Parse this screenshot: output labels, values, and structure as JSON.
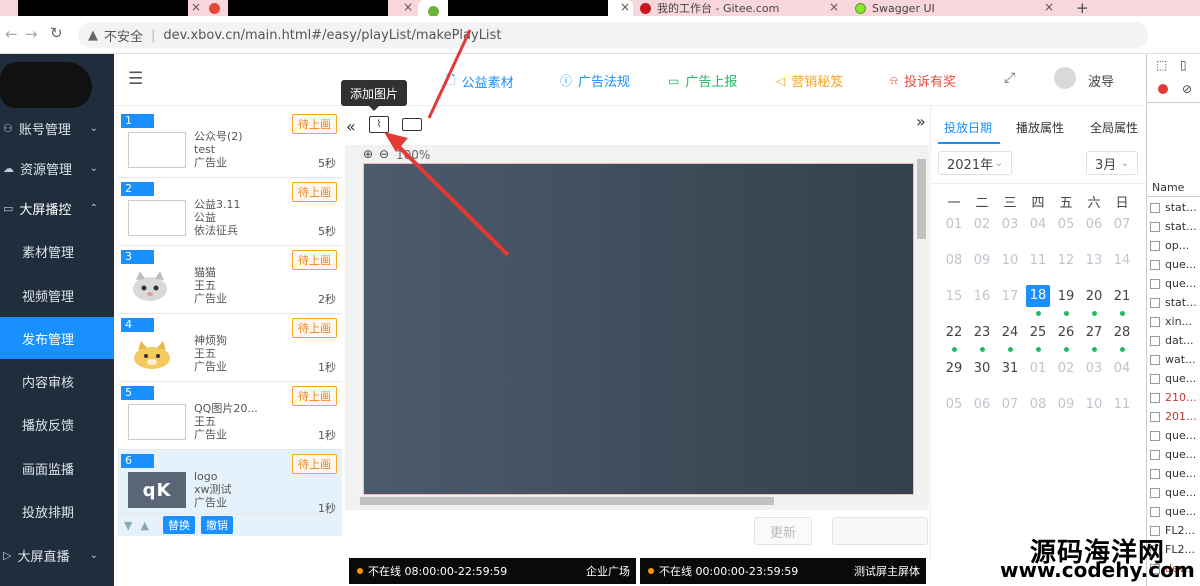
{
  "browser": {
    "tabs": [
      {
        "title": "我的工作台 - Gitee.com"
      },
      {
        "title": "Swagger UI"
      }
    ],
    "url": {
      "warning": "不安全",
      "address": "dev.xbov.cn/main.html#/easy/playList/makePlayList"
    }
  },
  "sidebar": {
    "items": [
      {
        "label": "账号管理",
        "icon": "user-icon"
      },
      {
        "label": "资源管理",
        "icon": "cloud-icon"
      },
      {
        "label": "大屏播控",
        "icon": "monitor-icon"
      },
      {
        "label": "素材管理"
      },
      {
        "label": "视频管理"
      },
      {
        "label": "发布管理"
      },
      {
        "label": "内容审核"
      },
      {
        "label": "播放反馈"
      },
      {
        "label": "画面监播"
      },
      {
        "label": "投放排期"
      },
      {
        "label": "大屏直播",
        "icon": "play-icon"
      }
    ]
  },
  "header": {
    "links": [
      {
        "label": "公益素材",
        "icon": "doc-icon",
        "color": "#1890ff"
      },
      {
        "label": "广告法规",
        "icon": "info-icon",
        "color": "#1890ff"
      },
      {
        "label": "广告上报",
        "icon": "monitor-icon",
        "color": "#25b864"
      },
      {
        "label": "营销秘笈",
        "icon": "horn-icon",
        "color": "#f5a623"
      },
      {
        "label": "投诉有奖",
        "icon": "alarm-icon",
        "color": "#e74c3c"
      }
    ],
    "user": "波导"
  },
  "playlist": [
    {
      "num": "1",
      "status": "待上画",
      "name": "公众号(2)",
      "sub": "test",
      "industry": "广告业",
      "duration": "5秒"
    },
    {
      "num": "2",
      "status": "待上画",
      "name": "公益3.11",
      "sub": "公益",
      "industry": "依法征兵",
      "duration": "5秒"
    },
    {
      "num": "3",
      "status": "待上画",
      "name": "猫猫",
      "sub": "王五",
      "industry": "广告业",
      "duration": "2秒"
    },
    {
      "num": "4",
      "status": "待上画",
      "name": "神烦狗",
      "sub": "王五",
      "industry": "广告业",
      "duration": "1秒"
    },
    {
      "num": "5",
      "status": "待上画",
      "name": "QQ图片20...",
      "sub": "王五",
      "industry": "广告业",
      "duration": "1秒"
    },
    {
      "num": "6",
      "status": "待上画",
      "name": "logo",
      "sub": "xw测试",
      "industry": "广告业",
      "duration": "1秒",
      "thumb_text": "qK"
    }
  ],
  "list_actions": {
    "replace": "替换",
    "revoke": "撤销"
  },
  "editor": {
    "tooltip": "添加图片",
    "zoom": "100%",
    "update_button": "更新"
  },
  "right_panel": {
    "tabs": [
      "投放日期",
      "播放属性",
      "全局属性"
    ],
    "year": "2021年",
    "month": "3月",
    "weekdays": [
      "一",
      "二",
      "三",
      "四",
      "五",
      "六",
      "日"
    ],
    "weeks": [
      [
        "01",
        "02",
        "03",
        "04",
        "05",
        "06",
        "07"
      ],
      [
        "08",
        "09",
        "10",
        "11",
        "12",
        "13",
        "14"
      ],
      [
        "15",
        "16",
        "17",
        "18",
        "19",
        "20",
        "21"
      ],
      [
        "22",
        "23",
        "24",
        "25",
        "26",
        "27",
        "28"
      ],
      [
        "29",
        "30",
        "31",
        "01",
        "02",
        "03",
        "04"
      ],
      [
        "05",
        "06",
        "07",
        "08",
        "09",
        "10",
        "11"
      ]
    ],
    "selected_day": "18"
  },
  "timelines": [
    {
      "status": "不在线 08:00:00-22:59:59",
      "place": "企业广场"
    },
    {
      "status": "不在线 00:00:00-23:59:59",
      "place": "测试屏主屏体"
    }
  ],
  "devtools": {
    "header": "Name",
    "rows": [
      "stat...",
      "stat...",
      "op...",
      "que...",
      "que...",
      "stat...",
      "xin...",
      "dat...",
      "wat...",
      "que...",
      "210...",
      "201...",
      "que...",
      "que...",
      "que...",
      "que...",
      "que...",
      "FL2...",
      "FL2...",
      "dev..."
    ]
  },
  "watermark": {
    "line1": "源码海洋网",
    "line2": "www.codehy.com"
  }
}
